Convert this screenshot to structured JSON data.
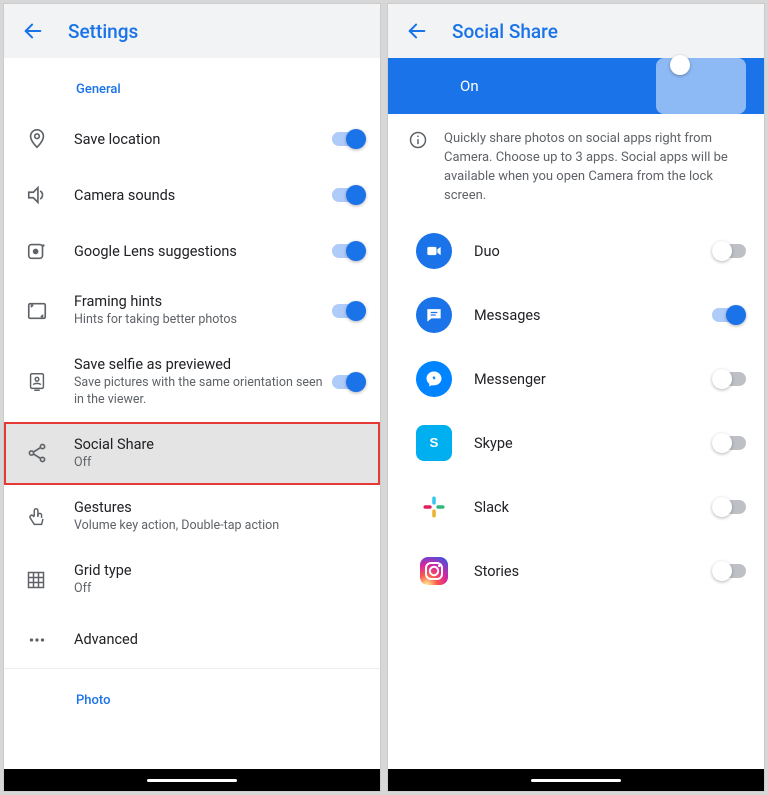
{
  "left": {
    "title": "Settings",
    "section_general": "General",
    "items": {
      "save_location": {
        "label": "Save location"
      },
      "camera_sounds": {
        "label": "Camera sounds"
      },
      "lens": {
        "label": "Google Lens suggestions"
      },
      "framing": {
        "label": "Framing hints",
        "sub": "Hints for taking better photos"
      },
      "selfie": {
        "label": "Save selfie as previewed",
        "sub": "Save pictures with the same orientation seen in the viewer."
      },
      "social": {
        "label": "Social Share",
        "sub": "Off"
      },
      "gestures": {
        "label": "Gestures",
        "sub": "Volume key action, Double-tap action"
      },
      "grid": {
        "label": "Grid type",
        "sub": "Off"
      },
      "advanced": {
        "label": "Advanced"
      }
    },
    "section_photo": "Photo"
  },
  "right": {
    "title": "Social Share",
    "banner_state": "On",
    "info": "Quickly share photos on social apps right from Camera. Choose up to 3 apps. Social apps will be available when you open Camera from the lock screen.",
    "apps": {
      "duo": {
        "label": "Duo",
        "on": false
      },
      "messages": {
        "label": "Messages",
        "on": true
      },
      "messenger": {
        "label": "Messenger",
        "on": false
      },
      "skype": {
        "label": "Skype",
        "on": false
      },
      "slack": {
        "label": "Slack",
        "on": false
      },
      "stories": {
        "label": "Stories",
        "on": false
      }
    }
  }
}
